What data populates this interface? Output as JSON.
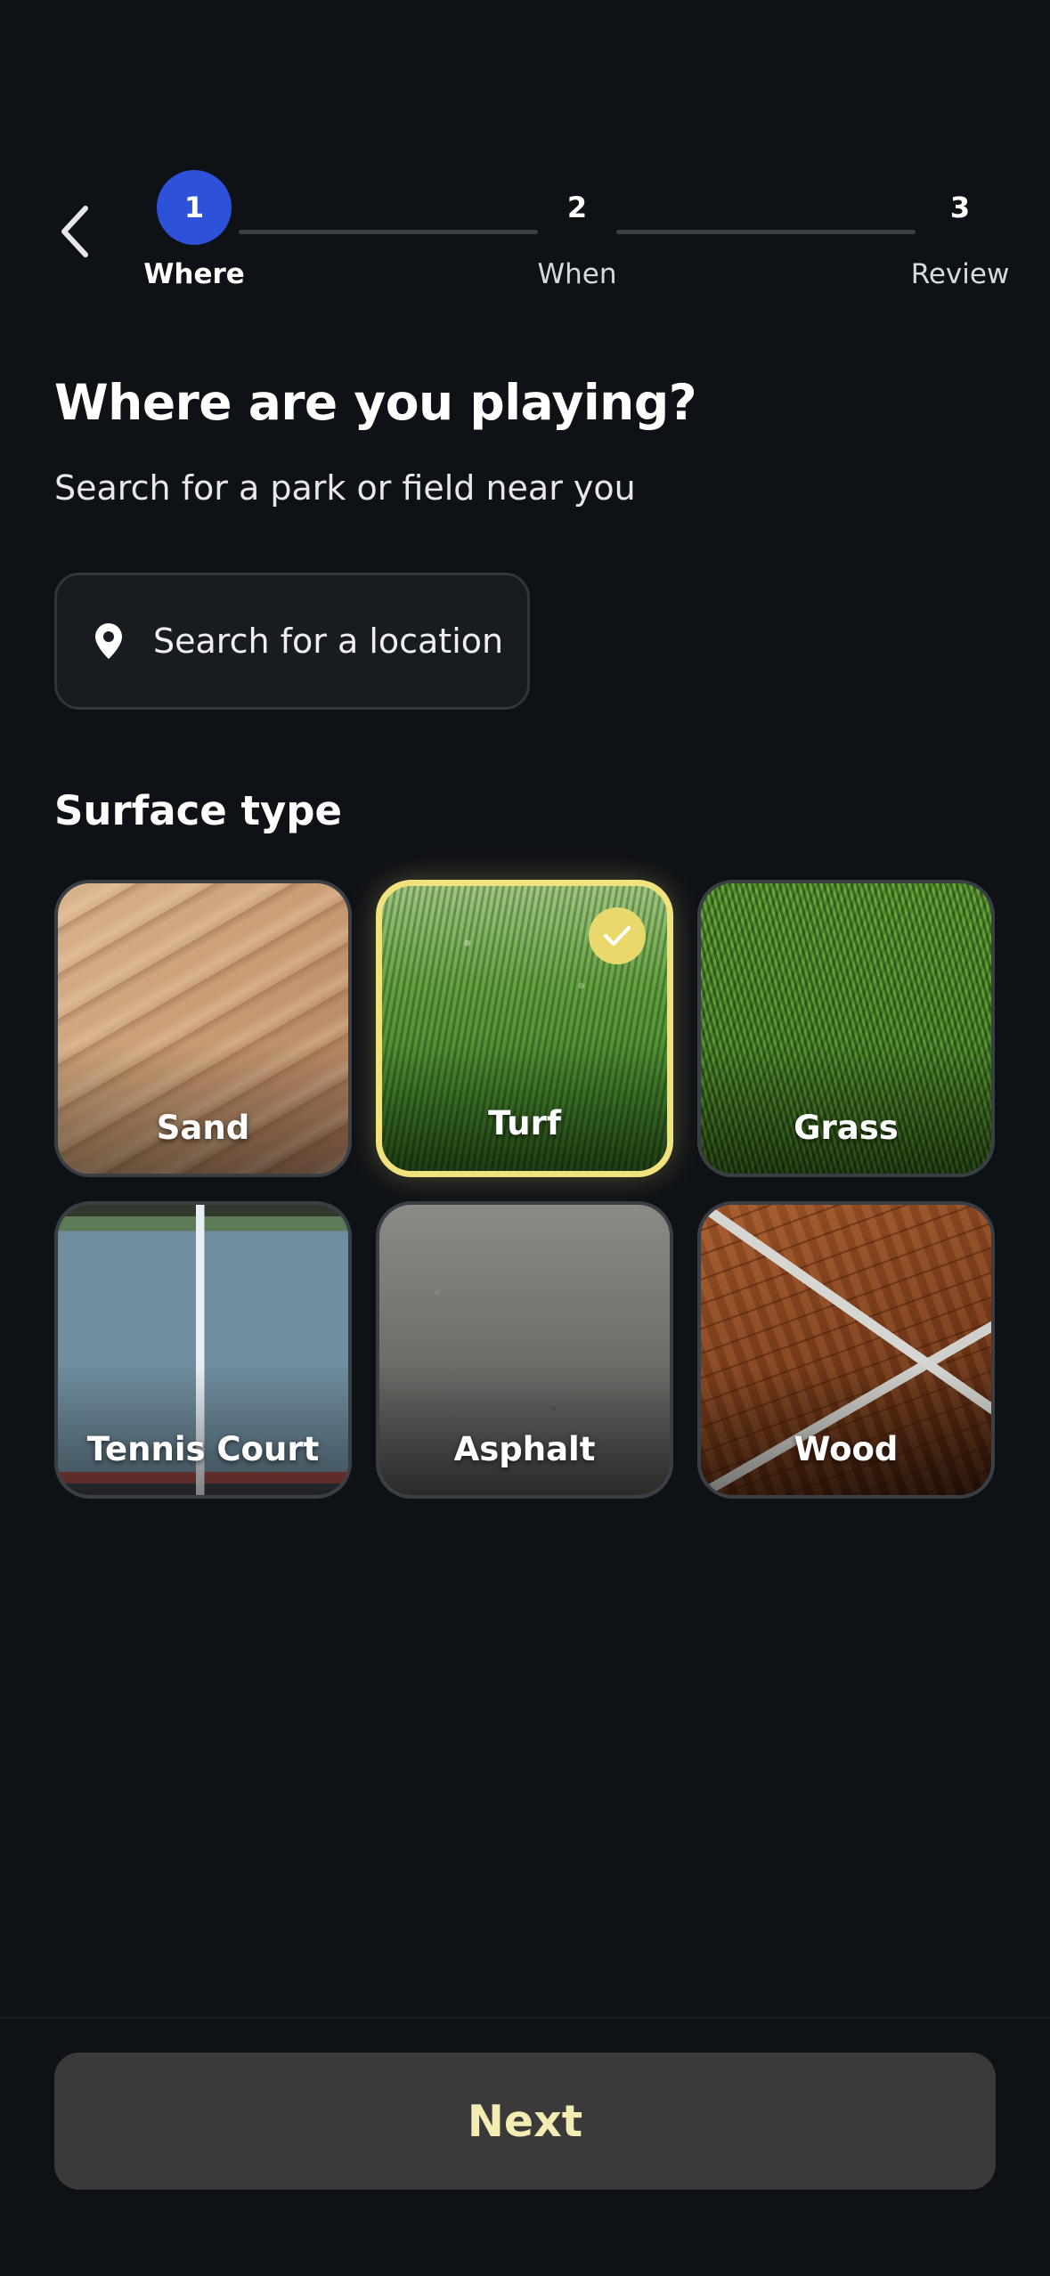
{
  "stepper": {
    "steps": [
      {
        "number": "1",
        "label": "Where",
        "active": true
      },
      {
        "number": "2",
        "label": "When",
        "active": false
      },
      {
        "number": "3",
        "label": "Review",
        "active": false
      }
    ]
  },
  "header": {
    "title": "Where are you playing?",
    "subtitle": "Search for a park or field near you"
  },
  "search": {
    "placeholder": "Search for a location",
    "icon": "location-pin-icon"
  },
  "surface": {
    "label": "Surface type",
    "selected": "Turf",
    "options": [
      {
        "label": "Sand",
        "texture": "sand"
      },
      {
        "label": "Turf",
        "texture": "turf"
      },
      {
        "label": "Grass",
        "texture": "grass"
      },
      {
        "label": "Tennis Court",
        "texture": "tennis"
      },
      {
        "label": "Asphalt",
        "texture": "asphalt"
      },
      {
        "label": "Wood",
        "texture": "wood"
      }
    ]
  },
  "footer": {
    "next_label": "Next"
  },
  "colors": {
    "background": "#0e1116",
    "active_step": "#2d52d9",
    "selected_border": "#f2e27d",
    "next_text": "#f5ecb4"
  }
}
